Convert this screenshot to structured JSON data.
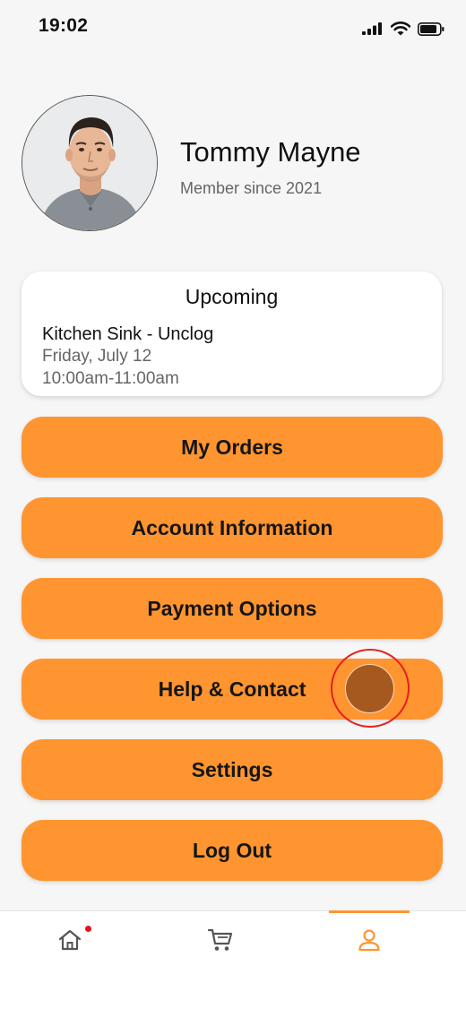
{
  "status_bar": {
    "time": "19:02"
  },
  "profile": {
    "name": "Tommy Mayne",
    "member_since": "Member since 2021"
  },
  "upcoming": {
    "title": "Upcoming",
    "service": "Kitchen Sink - Unclog",
    "date": "Friday, July 12",
    "time": "10:00am-11:00am"
  },
  "menu": {
    "my_orders": "My Orders",
    "account_information": "Account Information",
    "payment_options": "Payment Options",
    "help_contact": "Help & Contact",
    "settings": "Settings",
    "log_out": "Log Out"
  },
  "bottom_nav": {
    "items": [
      {
        "icon": "home-icon",
        "active": false,
        "has_notification": true
      },
      {
        "icon": "cart-icon",
        "active": false,
        "has_notification": false
      },
      {
        "icon": "profile-icon",
        "active": true,
        "has_notification": false
      }
    ]
  },
  "colors": {
    "accent": "#ff9530",
    "background": "#f6f6f6",
    "notification": "#e8111a"
  }
}
